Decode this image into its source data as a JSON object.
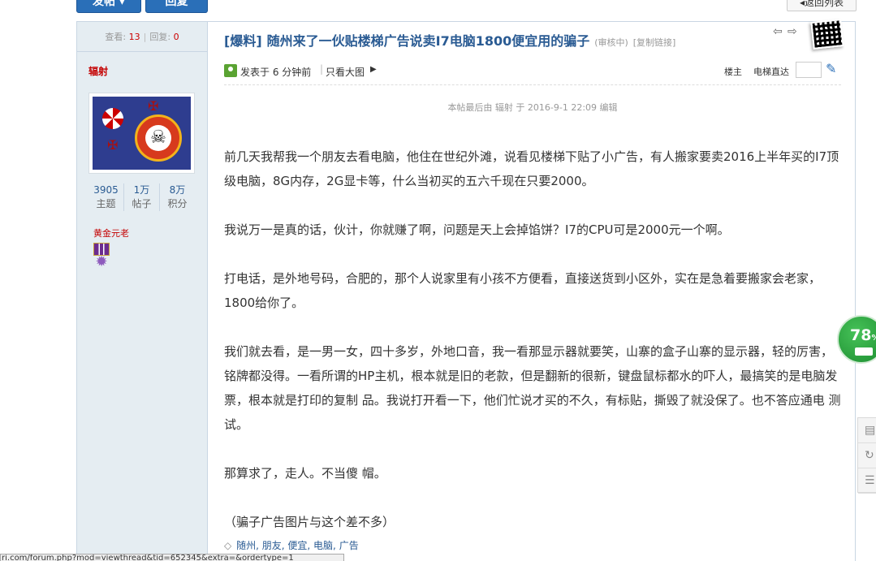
{
  "top_buttons": {
    "post_label": "发帖 ▾",
    "reply_label": "回复",
    "back_label": "返回列表"
  },
  "sidebar": {
    "views_label": "查看:",
    "views_value": "13",
    "replies_label": "回复:",
    "replies_value": "0",
    "author": "辐射",
    "avatar_glyph": "☠",
    "stats": [
      {
        "value": "3905",
        "label": "主题"
      },
      {
        "value": "1万",
        "label": "帖子"
      },
      {
        "value": "8万",
        "label": "积分"
      }
    ],
    "rank": "黄金元老"
  },
  "post": {
    "category": "[爆料]",
    "title": "随州来了一伙贴楼梯广告说卖I7电脑1800便宜用的骗子",
    "status": "(审核中)",
    "copy_link": "[复制链接]",
    "nav_prev": "⇦",
    "nav_next": "⇨",
    "posted_at": "发表于 6 分钟前",
    "only_author": "只看大图",
    "floor_label": "楼主",
    "elevator_label": "电梯直达",
    "edit_note": "本帖最后由 辐射 于 2016-9-1 22:09 编辑",
    "paragraphs": [
      "  前几天我帮我一个朋友去看电脑，他住在世纪外滩，说看见楼梯下贴了小广告，有人搬家要卖2016上半年买的I7顶级电脑，8G内存，2G显卡等，什么当初买的五六千现在只要2000。",
      "   我说万一是真的话，伙计，你就赚了啊，问题是天上会掉馅饼？I7的CPU可是2000元一个啊。",
      "  打电话，是外地号码，合肥的，那个人说家里有小孩不方便看，直接送货到小区外，实在是急着要搬家会老家，1800给你了。",
      "  我们就去看，是一男一女，四十多岁，外地口音，我一看那显示器就要笑，山寨的盒子山寨的显示器，轻的厉害，铭牌都没得。一看所谓的HP主机，根本就是旧的老款，但是翻新的很新，键盘鼠标都水的吓人，最搞笑的是电脑发票，根本就是打印的复制 品。我说打开看一下，他们忙说才买的不久，有标贴，撕毁了就没保了。也不答应通电 测试。",
      "  那算求了，走人。不当傻 帽。",
      "（骗子广告图片与这个差不多）"
    ],
    "tags": [
      "随州",
      "朋友",
      "便宜",
      "电脑",
      "广告"
    ]
  },
  "floating": {
    "battery_pct": "78",
    "battery_unit": "%"
  },
  "statusbar_url": "ri.com/forum.php?mod=viewthread&tid=652345&extra=&ordertype=1"
}
